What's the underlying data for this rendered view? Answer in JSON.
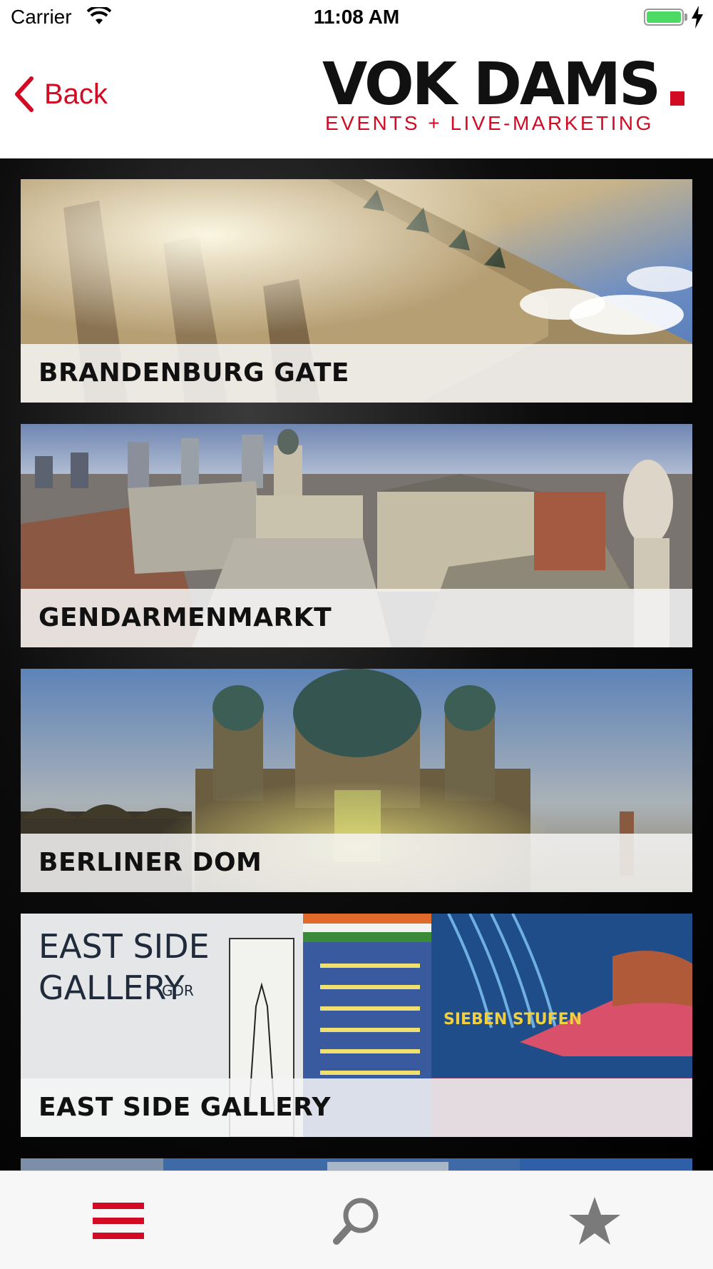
{
  "status_bar": {
    "carrier": "Carrier",
    "time": "11:08 AM",
    "battery_icon": "battery-full-charging-icon",
    "wifi_icon": "wifi-icon"
  },
  "nav": {
    "back_label": "Back",
    "back_icon": "chevron-left-icon",
    "logo": {
      "wordmark": "VOK DAMS",
      "tagline": "EVENTS + LIVE-MARKETING"
    }
  },
  "colors": {
    "accent": "#d20a23",
    "tabbar_bg": "#f7f7f7"
  },
  "places": [
    {
      "title": "BRANDENBURG GATE"
    },
    {
      "title": "GENDARMENMARKT"
    },
    {
      "title": "BERLINER DOM"
    },
    {
      "title": "EAST SIDE GALLERY"
    }
  ],
  "photo_texts": {
    "east_side_sign": [
      "EAST SIDE",
      "GALLERY"
    ],
    "east_side_sign_small": "GDR",
    "mural_text": "SIEBEN STUFEN"
  },
  "tab_bar": {
    "tabs": [
      {
        "icon": "menu-icon",
        "active": true
      },
      {
        "icon": "search-icon",
        "active": false
      },
      {
        "icon": "star-icon",
        "active": false
      }
    ]
  }
}
